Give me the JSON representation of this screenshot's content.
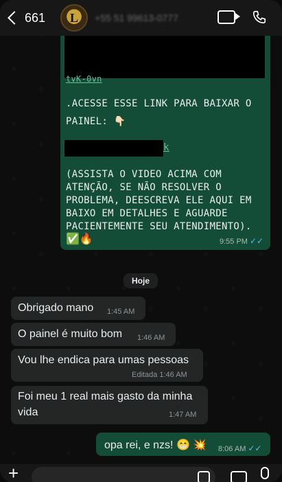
{
  "header": {
    "back_count": "661",
    "avatar_letter": "L",
    "contact_name": "+55 51 99613-0777"
  },
  "messages_top": {
    "link_fragment": "tvK-0vn",
    "line1": ".ACESSE ESSE LINK PARA BAIXAR O",
    "line2": "PAINEL: 👇🏻",
    "link_tail": "k",
    "para": [
      "(ASSISTA O VIDEO ACIMA COM",
      "ATENÇÃO, SE NÃO RESOLVER O",
      "PROBLEMA, DEESCREVA ELE AQUI EM",
      "BAIXO EM DETALHES E AGUARDE",
      "PACIENTEMENTE SEU ATENDIMENTO)."
    ],
    "emoji": "✅🔥",
    "time": "9:55 PM",
    "ticks": "✓✓"
  },
  "date_separator": "Hoje",
  "incoming": [
    {
      "text": "Obrigado mano",
      "time": "1:45 AM"
    },
    {
      "text": "O painel é muito bom",
      "time": "1:46 AM"
    },
    {
      "text": "Vou lhe endica para umas pessoas",
      "time": "Editada 1:46 AM"
    },
    {
      "text_l1": "Foi meu 1 real mais gasto da minha",
      "text_l2": "vida",
      "time": "1:47 AM"
    }
  ],
  "outgoing_last": {
    "text": "opa rei, e nzs! 😁 💥",
    "time": "8:06 AM",
    "ticks": "✓✓"
  },
  "composer": {
    "plus": "+"
  }
}
